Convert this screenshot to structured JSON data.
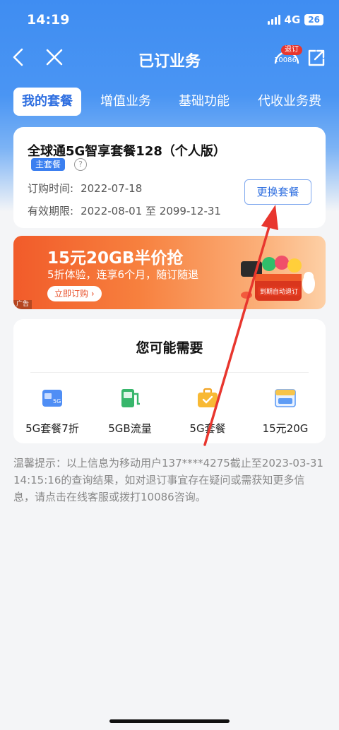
{
  "status_bar": {
    "time": "14:19",
    "network": "4G",
    "battery": "26"
  },
  "nav": {
    "title": "已订业务",
    "service_badge": "退订",
    "service_number": "10086"
  },
  "tabs": [
    {
      "label": "我的套餐",
      "active": true
    },
    {
      "label": "增值业务",
      "active": false
    },
    {
      "label": "基础功能",
      "active": false
    },
    {
      "label": "代收业务费",
      "active": false
    }
  ],
  "plan": {
    "name": "全球通5G智享套餐128（个人版）",
    "tag": "主套餐",
    "order_time_label": "订购时间:",
    "order_time": "2022-07-18",
    "valid_label": "有效期限:",
    "valid_range": "2022-08-01 至 2099-12-31",
    "change_button": "更换套餐"
  },
  "promo": {
    "title": "15元20GB半价抢",
    "subtitle": "5折体验，连享6个月，随订随退",
    "button": "立即订购 ›",
    "ad_label": "广告",
    "art_caption": "到期自动退订"
  },
  "recommend": {
    "title": "您可能需要",
    "items": [
      {
        "label": "5G套餐7折",
        "icon": "sim-card-icon"
      },
      {
        "label": "5GB流量",
        "icon": "data-pump-icon"
      },
      {
        "label": "5G套餐",
        "icon": "briefcase-icon"
      },
      {
        "label": "15元20G",
        "icon": "data-package-icon"
      }
    ]
  },
  "tip": "温馨提示：以上信息为移动用户137****4275截止至2023-03-31 14:15:16的查询结果，如对退订事宜存在疑问或需获知更多信息，请点击在线客服或拨打10086咨询。",
  "colors": {
    "primary": "#3f8df2",
    "accent_blue": "#2f6fe0",
    "promo_orange": "#f15b2a",
    "arrow_red": "#e8362e"
  }
}
